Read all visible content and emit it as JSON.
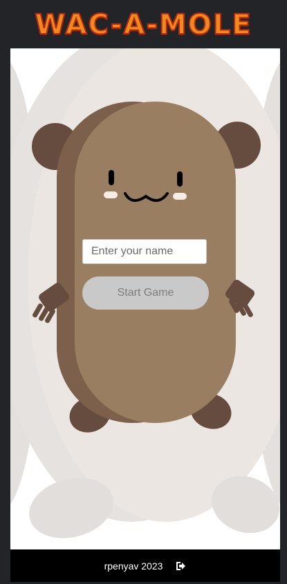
{
  "header": {
    "title": "WAC-A-MOLE"
  },
  "form": {
    "name_placeholder": "Enter your name",
    "start_label": "Start Game"
  },
  "footer": {
    "credit": "rpenyav 2023",
    "icon": "logout-icon"
  },
  "mole": {
    "face": "smiling-mole"
  },
  "colors": {
    "header_bg": "#222427",
    "mole_body": "#9a7e62",
    "mole_dark": "#664c3e",
    "button_bg": "#c9c9c9",
    "footer_bg": "#000000"
  }
}
